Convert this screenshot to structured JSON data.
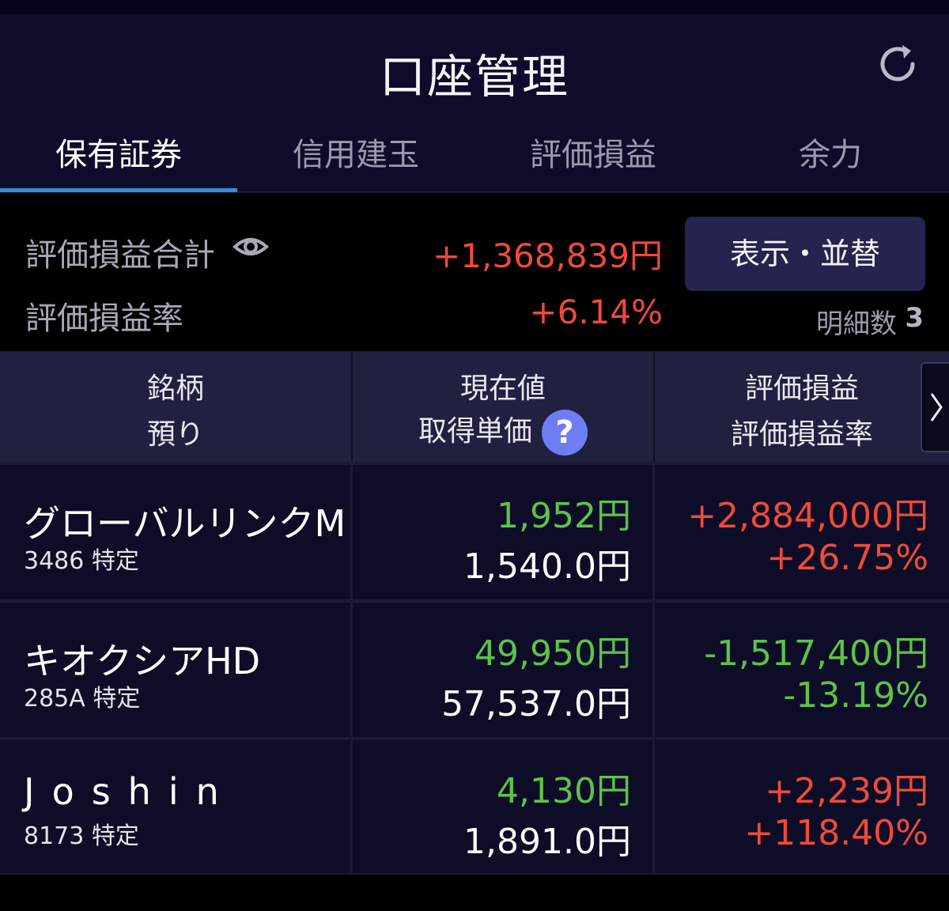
{
  "header": {
    "title": "口座管理",
    "refresh_icon": "refresh-icon"
  },
  "tabs": [
    {
      "label": "保有証券",
      "active": true
    },
    {
      "label": "信用建玉",
      "active": false
    },
    {
      "label": "評価損益",
      "active": false
    },
    {
      "label": "余力",
      "active": false
    }
  ],
  "summary": {
    "total_label": "評価損益合計",
    "total_value": "+1,368,839円",
    "rate_label": "評価損益率",
    "rate_value": "+6.14%",
    "sort_button": "表示・並替",
    "count_label": "明細数",
    "count_value": "3"
  },
  "table_header": {
    "col1_line1": "銘柄",
    "col1_line2": "預り",
    "col2_line1": "現在値",
    "col2_line2": "取得単価",
    "help_glyph": "?",
    "col3_line1": "評価損益",
    "col3_line2": "評価損益率",
    "next_glyph": "〉"
  },
  "rows": [
    {
      "name": "グローバルリンクM",
      "code": "3486 特定",
      "price": "1,952円",
      "cost": "1,540.0円",
      "pl": "+2,884,000円",
      "pl_rate": "+26.75%"
    },
    {
      "name": "キオクシアHD",
      "code": "285A 特定",
      "price": "49,950円",
      "cost": "57,537.0円",
      "pl": "-1,517,400円",
      "pl_rate": "-13.19%"
    },
    {
      "name": "Joshin",
      "code": "8173 特定",
      "price": "4,130円",
      "cost": "1,891.0円",
      "pl": "+2,239円",
      "pl_rate": "+118.40%"
    }
  ],
  "colors": {
    "positive": "#ef4a3a",
    "negative": "#5ec24a",
    "accent": "#3f8ad6"
  }
}
